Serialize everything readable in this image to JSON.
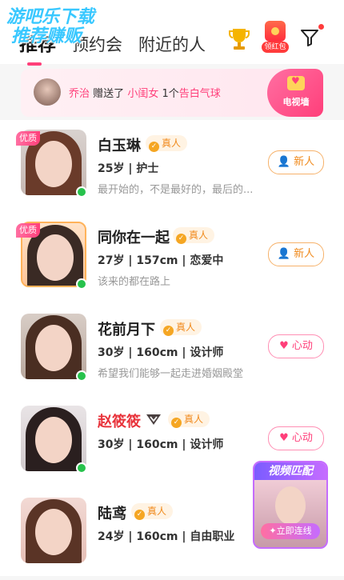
{
  "watermark": {
    "line1": "游吧乐下载",
    "line2": "推荐赚贩"
  },
  "tabs": [
    {
      "label": "推荐",
      "active": true
    },
    {
      "label": "预约会",
      "active": false
    },
    {
      "label": "附近的人",
      "active": false
    }
  ],
  "header": {
    "redpack_label": "领红包"
  },
  "notice": {
    "from": "乔治",
    "verb": "赠送了",
    "to": "小闺女",
    "count": "1个",
    "gift": "告白气球",
    "tv_label": "电视墙"
  },
  "users": [
    {
      "quality": "优质",
      "name": "白玉琳",
      "verified": "真人",
      "info": "25岁 | 护士",
      "bio": "最开始的，不是最好的，最后的...",
      "action": "新人",
      "online": true
    },
    {
      "quality": "优质",
      "name": "同你在一起",
      "verified": "真人",
      "info": "27岁 | 157cm | 恋爱中",
      "bio": "该来的都在路上",
      "action": "新人",
      "online": true
    },
    {
      "quality": "",
      "name": "花前月下",
      "verified": "真人",
      "info": "30岁 | 160cm | 设计师",
      "bio": "希望我们能够一起走进婚姻殿堂",
      "action": "心动",
      "online": true
    },
    {
      "quality": "",
      "name": "赵筱筱",
      "verified": "真人",
      "info": "30岁 | 160cm | 设计师",
      "bio": "",
      "action": "心动",
      "online": true
    },
    {
      "quality": "",
      "name": "陆鸢",
      "verified": "真人",
      "info": "24岁 | 160cm | 自由职业",
      "bio": "",
      "action": "",
      "online": false
    }
  ],
  "video_match": {
    "title": "视频匹配",
    "button": "立即连线"
  },
  "colors": {
    "accent": "#ff3f7a",
    "verified": "#f08a1c",
    "online": "#27c24c"
  }
}
